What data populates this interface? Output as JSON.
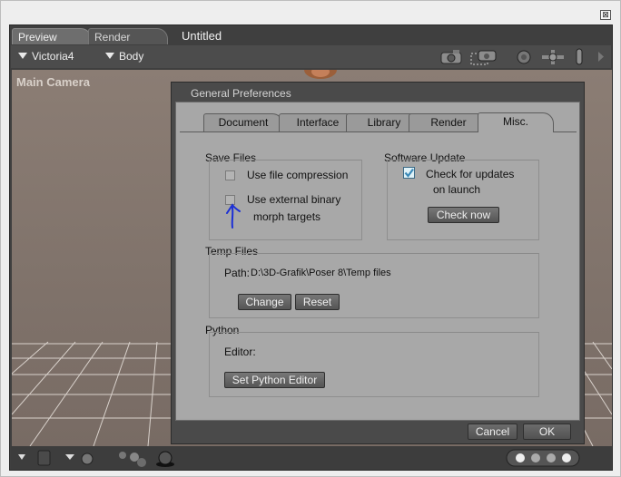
{
  "window": {
    "close_glyph": "⊠"
  },
  "app_tabs": {
    "preview": "Preview",
    "render": "Render",
    "document_title": "Untitled"
  },
  "toolbar": {
    "figure": "Victoria4",
    "element": "Body"
  },
  "viewport": {
    "label": "Main Camera"
  },
  "dialog": {
    "title": "General Preferences",
    "tabs": [
      "Document",
      "Interface",
      "Library",
      "Render",
      "Misc."
    ],
    "active_tab": "Misc.",
    "save_files": {
      "title": "Save Files",
      "compression_label": "Use file compression",
      "compression_checked": false,
      "binary_label_1": "Use external binary",
      "binary_label_2": "morph targets",
      "binary_checked": false
    },
    "software_update": {
      "title": "Software Update",
      "check_label_1": "Check for updates",
      "check_label_2": "on launch",
      "check_checked": true,
      "check_now": "Check now"
    },
    "temp_files": {
      "title": "Temp Files",
      "path_label": "Path:",
      "path_value": "D:\\3D-Grafik\\Poser 8\\Temp files",
      "change": "Change",
      "reset": "Reset"
    },
    "python": {
      "title": "Python",
      "editor_label": "Editor:",
      "set_editor": "Set Python Editor"
    },
    "cancel": "Cancel",
    "ok": "OK"
  },
  "colors": {
    "accent_check": "#3a89b8",
    "annotation": "#1b2fd6"
  }
}
